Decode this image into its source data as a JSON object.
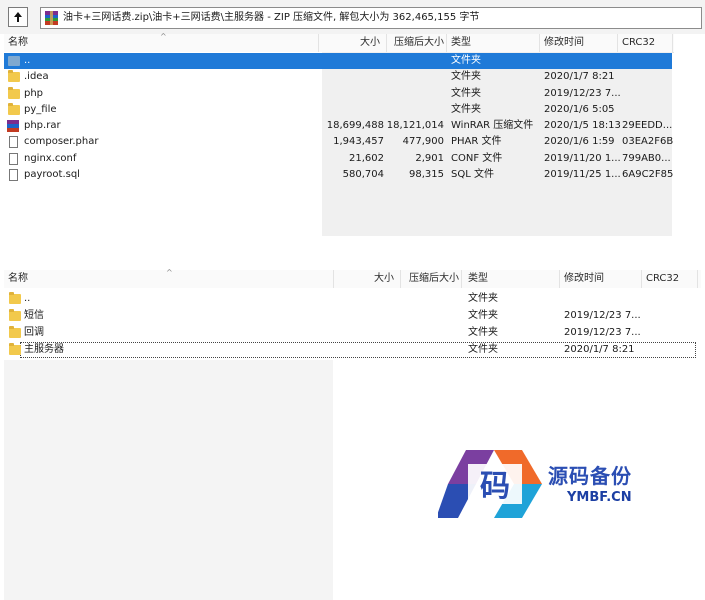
{
  "address_bar": {
    "path": "油卡+三网话费.zip\\油卡+三网话费\\主服务器 - ZIP 压缩文件, 解包大小为 362,465,155 字节"
  },
  "top_pane": {
    "columns": [
      "名称",
      "大小",
      "压缩后大小",
      "类型",
      "修改时间",
      "CRC32"
    ],
    "rows": [
      {
        "icon": "up-folder",
        "name": "..",
        "size": "",
        "packed": "",
        "type": "文件夹",
        "modified": "",
        "crc": "",
        "selected": true
      },
      {
        "icon": "folder",
        "name": ".idea",
        "size": "",
        "packed": "",
        "type": "文件夹",
        "modified": "2020/1/7 8:21",
        "crc": ""
      },
      {
        "icon": "folder",
        "name": "php",
        "size": "",
        "packed": "",
        "type": "文件夹",
        "modified": "2019/12/23 7...",
        "crc": ""
      },
      {
        "icon": "folder",
        "name": "py_file",
        "size": "",
        "packed": "",
        "type": "文件夹",
        "modified": "2020/1/6 5:05",
        "crc": ""
      },
      {
        "icon": "rar",
        "name": "php.rar",
        "size": "18,699,488",
        "packed": "18,121,014",
        "type": "WinRAR 压缩文件",
        "modified": "2020/1/5 18:13",
        "crc": "29EEDD..."
      },
      {
        "icon": "file",
        "name": "composer.phar",
        "size": "1,943,457",
        "packed": "477,900",
        "type": "PHAR 文件",
        "modified": "2020/1/6 1:59",
        "crc": "03EA2F6B"
      },
      {
        "icon": "file",
        "name": "nginx.conf",
        "size": "21,602",
        "packed": "2,901",
        "type": "CONF 文件",
        "modified": "2019/11/20 1...",
        "crc": "799AB0..."
      },
      {
        "icon": "file",
        "name": "payroot.sql",
        "size": "580,704",
        "packed": "98,315",
        "type": "SQL 文件",
        "modified": "2019/11/25 1...",
        "crc": "6A9C2F85"
      }
    ]
  },
  "bottom_pane": {
    "columns": [
      "名称",
      "大小",
      "压缩后大小",
      "类型",
      "修改时间",
      "CRC32"
    ],
    "rows": [
      {
        "icon": "folder",
        "name": "..",
        "type": "文件夹",
        "modified": ""
      },
      {
        "icon": "folder",
        "name": "短信",
        "type": "文件夹",
        "modified": "2019/12/23 7..."
      },
      {
        "icon": "folder",
        "name": "回调",
        "type": "文件夹",
        "modified": "2019/12/23 7..."
      },
      {
        "icon": "folder",
        "name": "主服务器",
        "type": "文件夹",
        "modified": "2020/1/7 8:21",
        "focused": true
      }
    ]
  },
  "watermark": {
    "logo_char": "码",
    "text": "源码备份",
    "sub": "YMBF.CN",
    "colors": {
      "blue": "#2b4eb3",
      "purple": "#7b3fa0",
      "orange": "#f06a2a"
    }
  },
  "colors": {
    "selection": "#1f7ad8",
    "folder": "#f2c94c"
  }
}
